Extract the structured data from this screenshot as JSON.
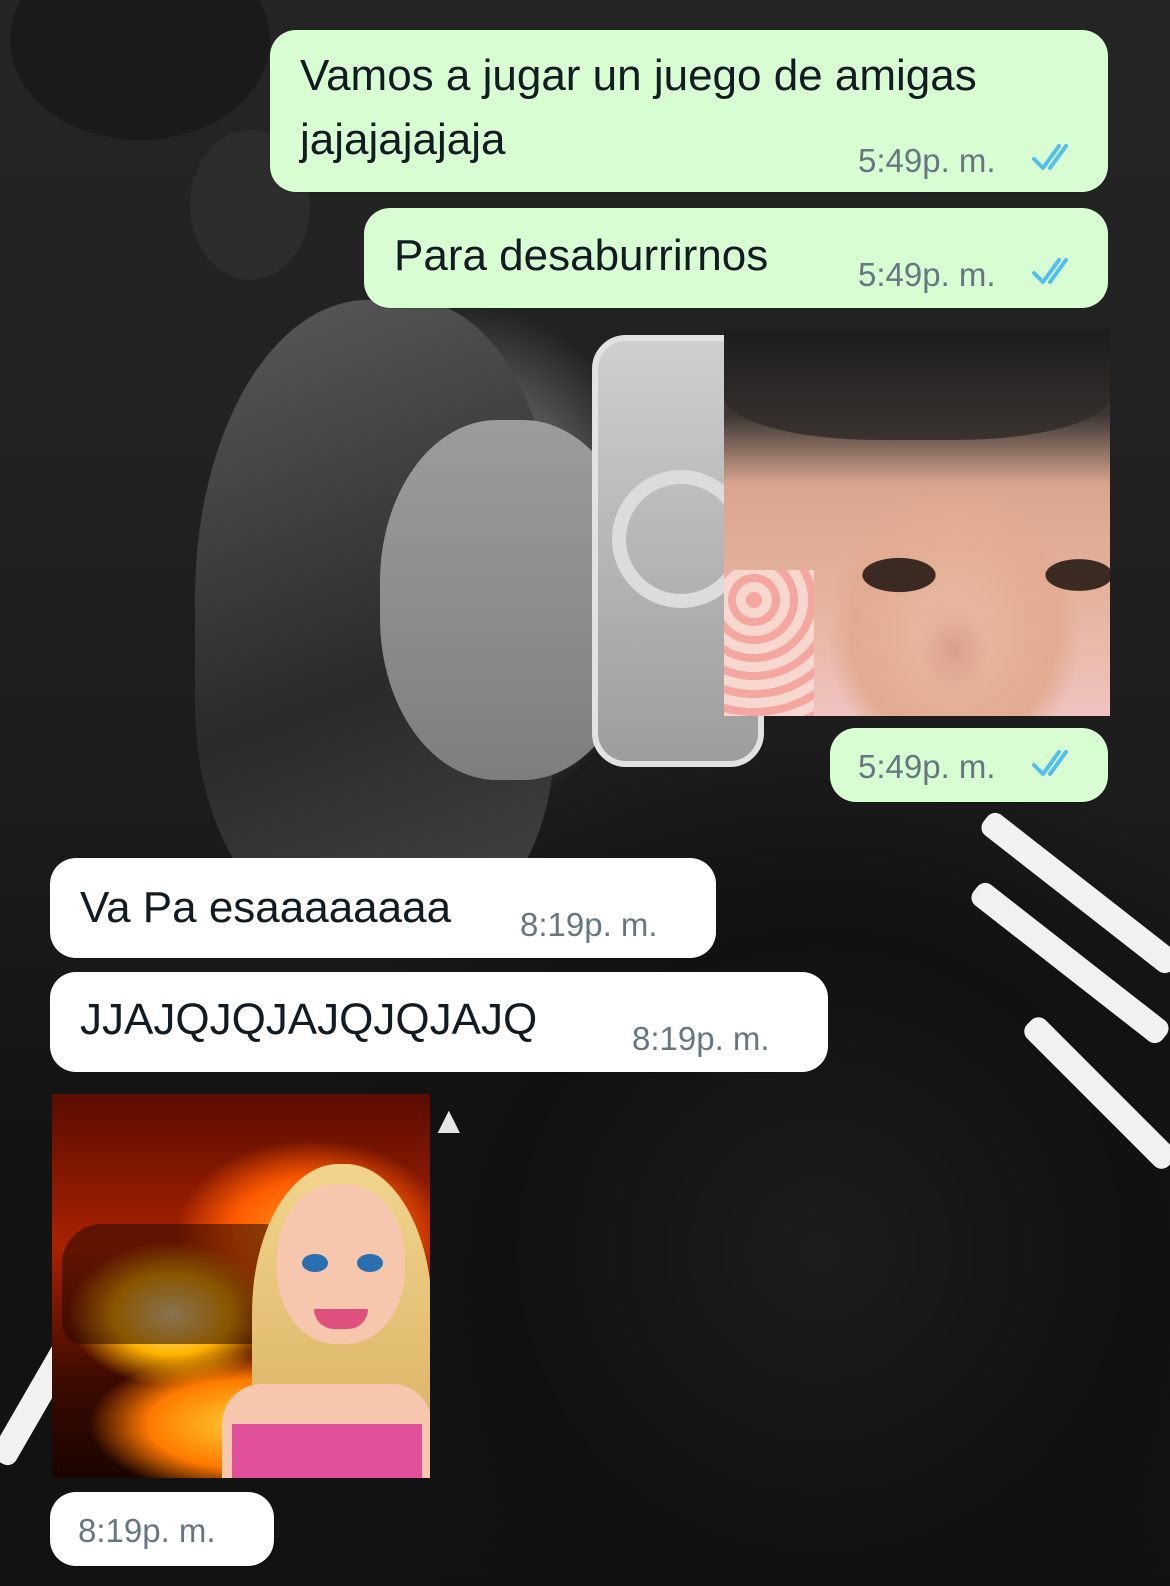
{
  "messages": [
    {
      "direction": "outgoing",
      "type": "text",
      "lines": [
        "Vamos a jugar un juego de amigas",
        "jajajajajaja"
      ],
      "time": "5:49p. m.",
      "status": "read"
    },
    {
      "direction": "outgoing",
      "type": "text",
      "text": "Para desaburrirnos",
      "time": "5:49p. m.",
      "status": "read"
    },
    {
      "direction": "outgoing",
      "type": "sticker",
      "sticker": "baby-sticking-tongue-out",
      "time": "5:49p. m.",
      "status": "read"
    },
    {
      "direction": "incoming",
      "type": "text",
      "text": "Va Pa esaaaaaaaa",
      "time": "8:19p. m."
    },
    {
      "direction": "incoming",
      "type": "text",
      "text": "JJAJQJQJAJQJQJAJQ",
      "time": "8:19p. m."
    },
    {
      "direction": "incoming",
      "type": "sticker",
      "sticker": "barbie-burning-car",
      "time": "8:19p. m."
    }
  ],
  "colors": {
    "outgoing_bubble": "#d9fdd3",
    "incoming_bubble": "#ffffff",
    "read_ticks": "#53bdeb",
    "timestamp": "#667781"
  },
  "icons": {
    "read_receipt": "double-check-icon"
  }
}
